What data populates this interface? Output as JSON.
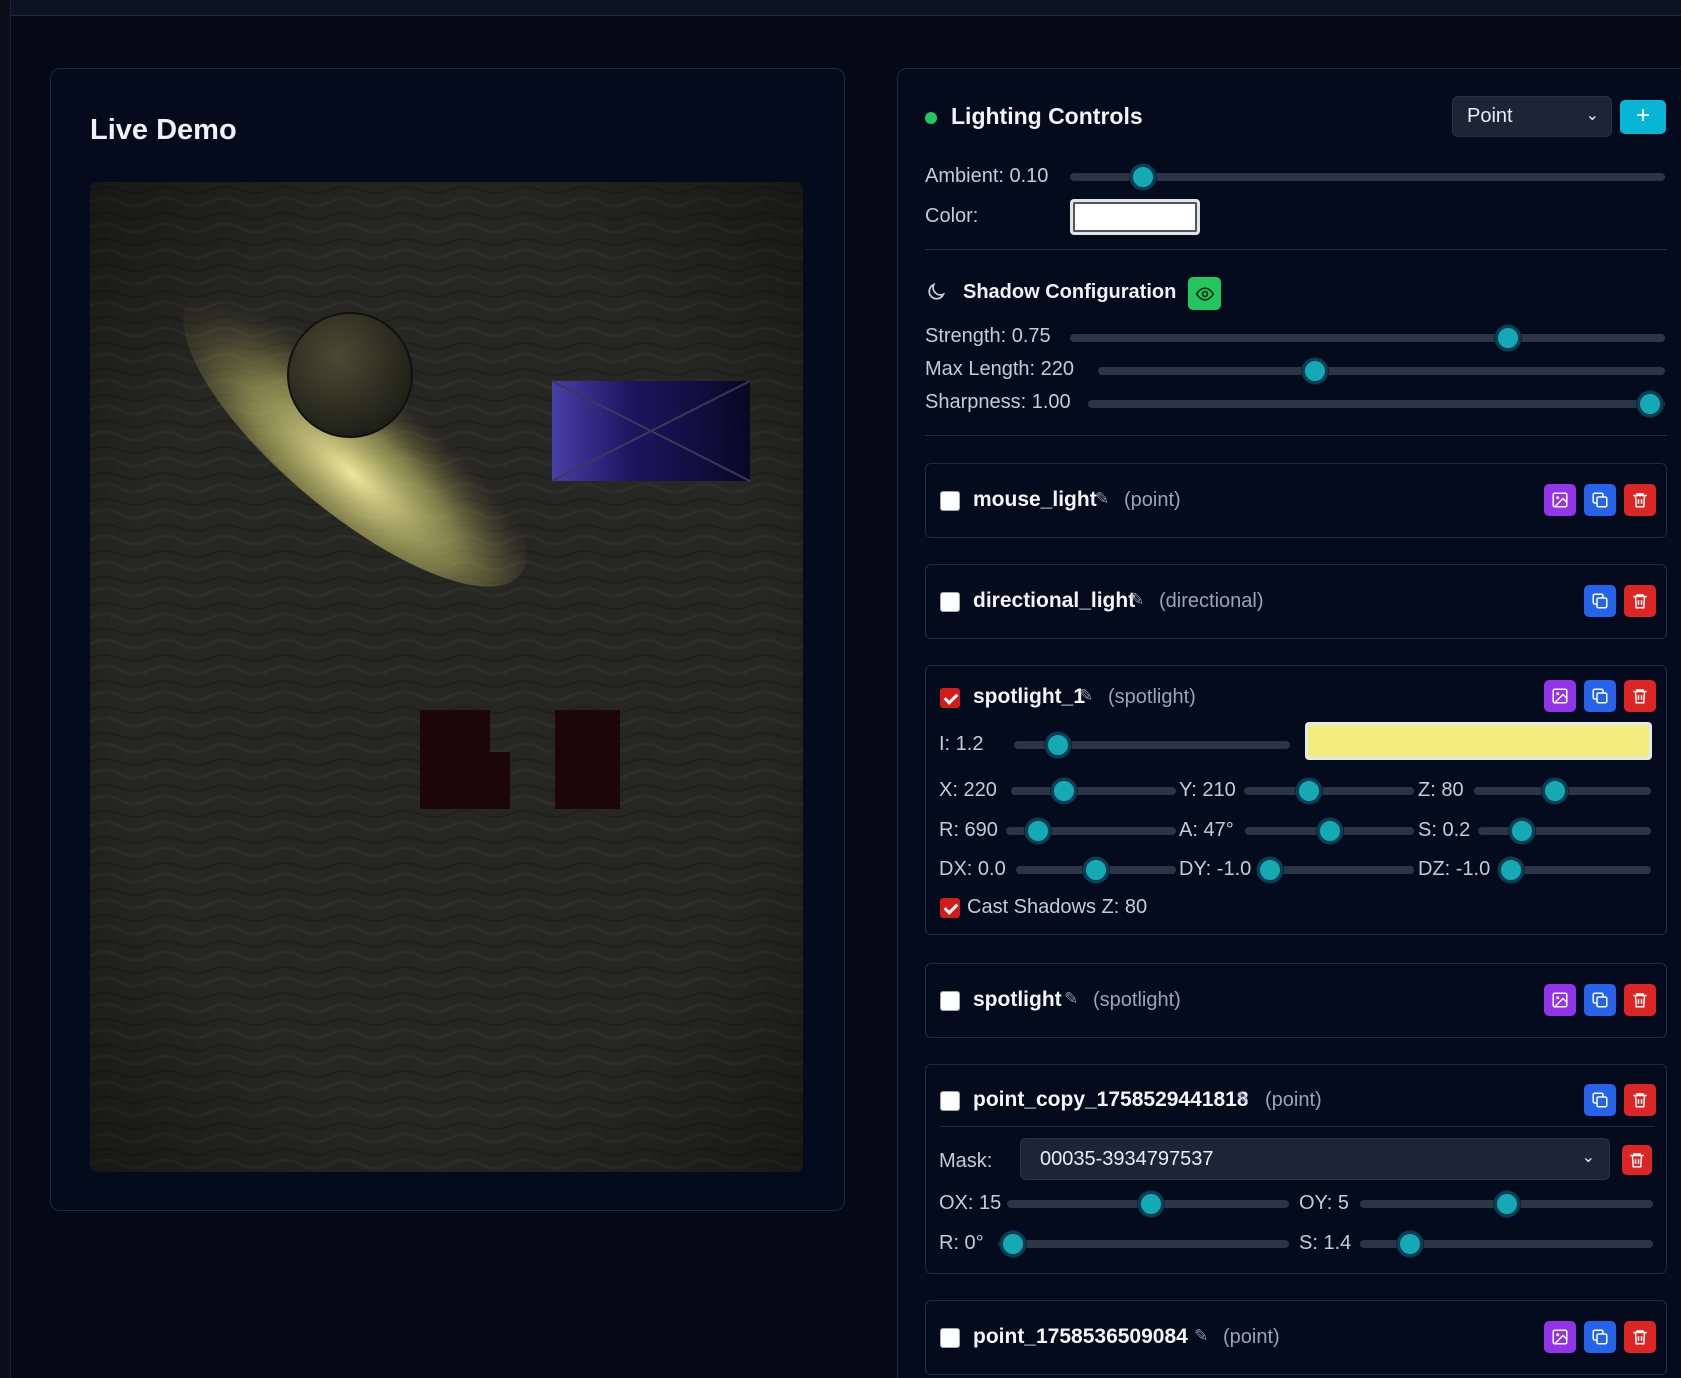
{
  "demo": {
    "title": "Live Demo"
  },
  "header": {
    "title": "Lighting Controls",
    "light_type_selected": "Point",
    "add_label": "+"
  },
  "global": {
    "ambient_label": "Ambient: 0.10",
    "ambient_value": 0.1,
    "color_label": "Color:",
    "color_value": "#ffffff"
  },
  "shadow": {
    "title": "Shadow Configuration",
    "strength_label": "Strength: 0.75",
    "strength_value": 0.75,
    "max_length_label": "Max Length: 220",
    "max_length_value": 220,
    "sharpness_label": "Sharpness: 1.00",
    "sharpness_value": 1.0
  },
  "lights": [
    {
      "name": "mouse_light",
      "type": "(point)",
      "checked": false
    },
    {
      "name": "directional_light",
      "type": "(directional)",
      "checked": false
    },
    {
      "name": "spotlight_1",
      "type": "(spotlight)",
      "checked": true,
      "intensity_label": "I: 1.2",
      "color": "#f2ec7c",
      "x_label": "X: 220",
      "y_label": "Y: 210",
      "z_label": "Z: 80",
      "r_label": "R: 690",
      "a_label": "A: 47°",
      "s_label": "S: 0.2",
      "dx_label": "DX: 0.0",
      "dy_label": "DY: -1.0",
      "dz_label": "DZ: -1.0",
      "cast_shadows_label": "Cast Shadows Z: 80"
    },
    {
      "name": "spotlight",
      "type": "(spotlight)",
      "checked": false
    },
    {
      "name": "point_copy_1758529441818",
      "type": "(point)",
      "checked": false,
      "mask_label": "Mask:",
      "mask_value": "00035-3934797537",
      "ox_label": "OX: 15",
      "oy_label": "OY: 5",
      "r_label": "R: 0°",
      "s_label": "S: 1.4"
    },
    {
      "name": "point_1758536509084",
      "type": "(point)",
      "checked": false
    }
  ],
  "colors": {
    "accent": "#14a9b3",
    "status_dot": "#22c55e",
    "add_button": "#06b6d4",
    "eye_button": "#22c55e",
    "purple": "#9333ea",
    "blue": "#2563eb",
    "red": "#dc2626"
  }
}
